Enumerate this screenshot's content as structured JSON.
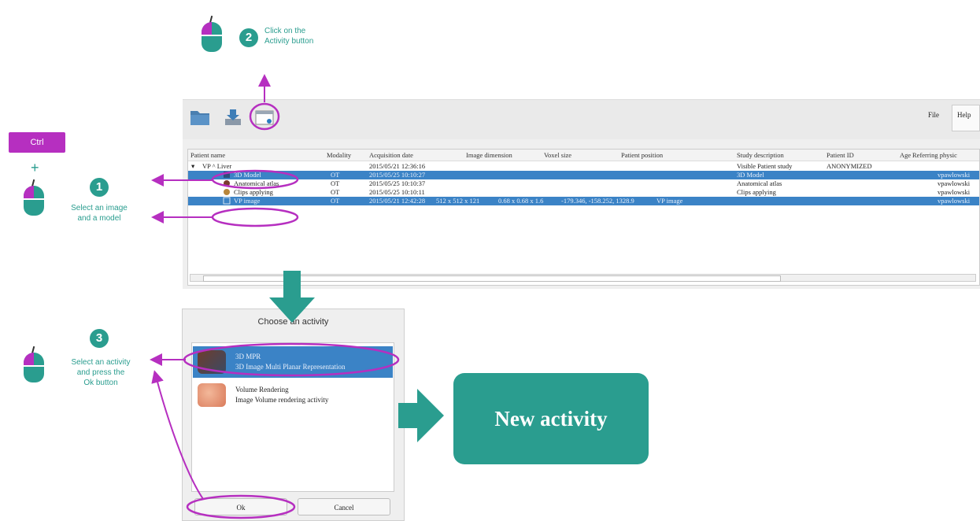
{
  "colors": {
    "accent_teal": "#2a9d8f",
    "accent_purple": "#b62fc0",
    "selection_blue": "#3b83c6"
  },
  "steps": {
    "step2": {
      "number": "2",
      "text_line1": "Click on the",
      "text_line2": "Activity button"
    },
    "ctrl_key": "Ctrl",
    "plus": "+",
    "step1": {
      "number": "1",
      "text_line1": "Select an image",
      "text_line2": "and a model"
    },
    "step3": {
      "number": "3",
      "text_line1": "Select an activity",
      "text_line2": "and press the",
      "text_line3": "Ok button"
    }
  },
  "toolbar": {
    "icons": [
      "folder-icon",
      "import-icon",
      "activity-icon"
    ],
    "menu_file": "File",
    "menu_help": "Help"
  },
  "table": {
    "columns": [
      "Patient name",
      "Modality",
      "Acquisition date",
      "Image dimension",
      "Voxel size",
      "Patient position",
      "Study description",
      "Patient ID",
      "Age",
      "Referring physic"
    ],
    "rows": [
      {
        "name": "VP ^ Liver",
        "modality": "",
        "date": "2015/05/21 12:36:16",
        "dim": "",
        "voxel": "",
        "position": "",
        "study": "Visible Patient study",
        "pid": "ANONYMIZED",
        "age": "",
        "ref": "",
        "selected": false
      },
      {
        "name": "3D Model",
        "modality": "OT",
        "date": "2015/05/25 10:10:27",
        "dim": "",
        "voxel": "",
        "position": "",
        "study": "3D Model",
        "pid": "",
        "age": "",
        "ref": "vpawlowski",
        "selected": true
      },
      {
        "name": "Anatomical atlas",
        "modality": "OT",
        "date": "2015/05/25 10:10:37",
        "dim": "",
        "voxel": "",
        "position": "",
        "study": "Anatomical atlas",
        "pid": "",
        "age": "",
        "ref": "vpawlowski",
        "selected": false
      },
      {
        "name": "Clips applying",
        "modality": "OT",
        "date": "2015/05/25 10:10:11",
        "dim": "",
        "voxel": "",
        "position": "",
        "study": "Clips applying",
        "pid": "",
        "age": "",
        "ref": "vpawlowski",
        "selected": false
      },
      {
        "name": "VP image",
        "modality": "OT",
        "date": "2015/05/21 12:42:28",
        "dim": "512 x 512 x 121",
        "voxel": "0.68 x 0.68 x 1.6",
        "position": "-179.346, -158.252, 1328.9",
        "study": "VP image",
        "pid": "",
        "age": "",
        "ref": "vpawlowski",
        "selected": true
      }
    ]
  },
  "dialog": {
    "title": "Choose an activity",
    "activities": [
      {
        "name": "3D MPR",
        "description": "3D Image Multi Planar Representation",
        "selected": true
      },
      {
        "name": "Volume Rendering",
        "description": "Image Volume rendering activity",
        "selected": false
      }
    ],
    "ok_label": "Ok",
    "cancel_label": "Cancel"
  },
  "result": {
    "label": "New activity"
  }
}
